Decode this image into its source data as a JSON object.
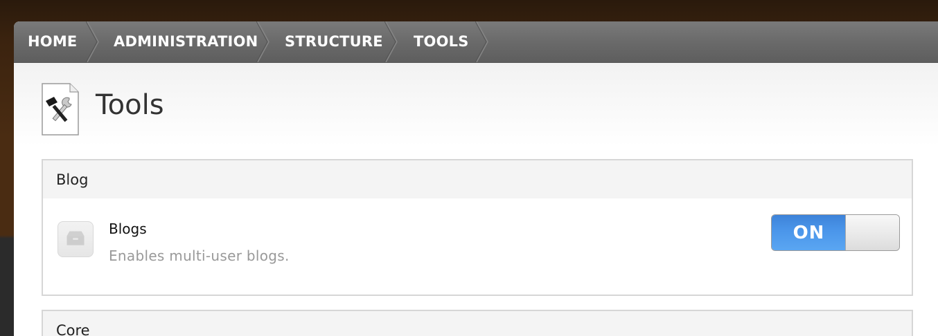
{
  "breadcrumb": {
    "items": [
      {
        "label": "HOME"
      },
      {
        "label": "ADMINISTRATION"
      },
      {
        "label": "STRUCTURE"
      },
      {
        "label": "TOOLS"
      }
    ]
  },
  "page": {
    "title": "Tools",
    "icon": "tools-icon"
  },
  "sections": [
    {
      "title": "Blog",
      "modules": [
        {
          "name": "Blogs",
          "description": "Enables multi-user blogs.",
          "icon": "module-box-icon",
          "toggle_label": "ON",
          "enabled": true
        }
      ]
    },
    {
      "title": "Core"
    }
  ],
  "colors": {
    "toggle_on": "#4b96ea",
    "breadcrumb_bar": "#6a6a6a",
    "section_border": "#d6d6d6"
  }
}
